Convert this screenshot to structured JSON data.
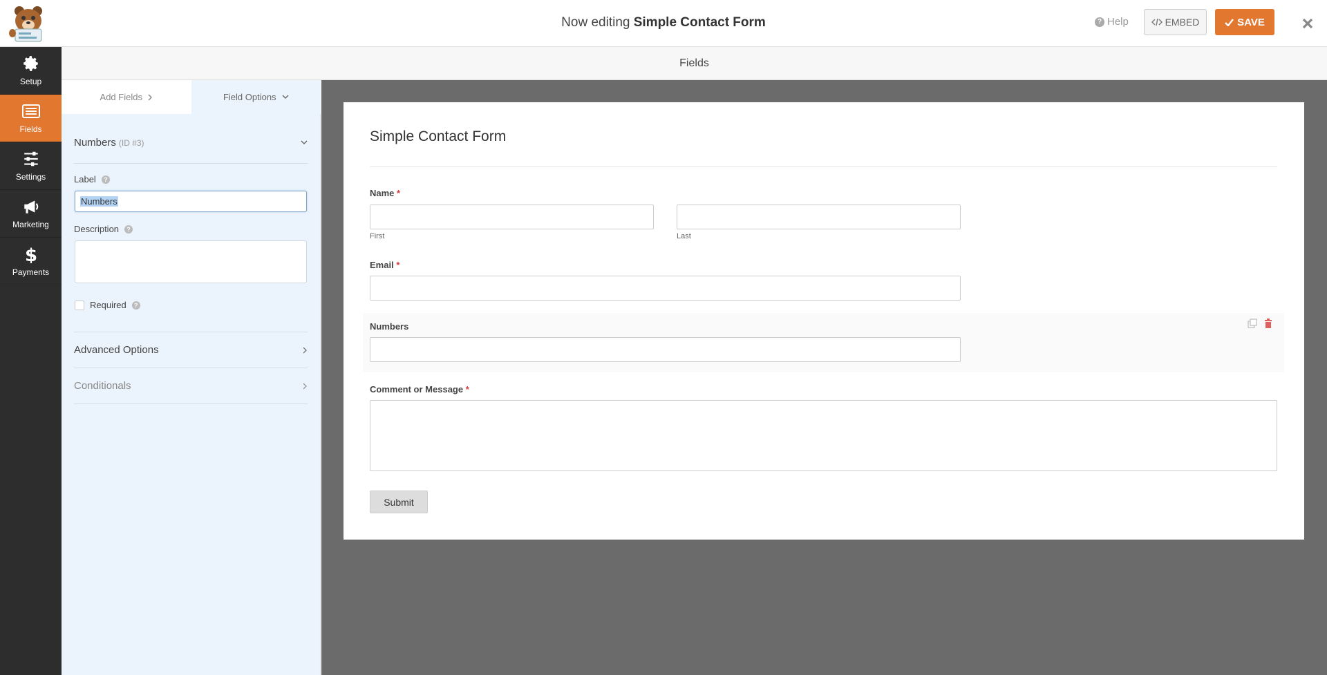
{
  "header": {
    "title_prefix": "Now editing",
    "title_form": "Simple Contact Form",
    "help_label": "Help",
    "embed_label": "EMBED",
    "save_label": "SAVE"
  },
  "nav": {
    "items": [
      {
        "label": "Setup",
        "icon": "gear-icon"
      },
      {
        "label": "Fields",
        "icon": "fields-icon"
      },
      {
        "label": "Settings",
        "icon": "sliders-icon"
      },
      {
        "label": "Marketing",
        "icon": "megaphone-icon"
      },
      {
        "label": "Payments",
        "icon": "dollar-icon"
      }
    ],
    "active": "Fields"
  },
  "section_title": "Fields",
  "panel": {
    "tabs": {
      "add_fields": "Add Fields",
      "field_options": "Field Options"
    },
    "field_name": "Numbers",
    "field_id": "(ID #3)",
    "label_label": "Label",
    "label_value": "Numbers",
    "description_label": "Description",
    "required_label": "Required",
    "advanced_options": "Advanced Options",
    "conditionals": "Conditionals"
  },
  "form": {
    "title": "Simple Contact Form",
    "name_label": "Name",
    "first_label": "First",
    "last_label": "Last",
    "email_label": "Email",
    "numbers_label": "Numbers",
    "message_label": "Comment or Message",
    "required_star": "*",
    "submit_label": "Submit"
  },
  "colors": {
    "accent": "#e27730",
    "nav_bg": "#2d2d2d",
    "panel_bg": "#ebf3fc",
    "preview_bg": "#6b6b6b"
  }
}
